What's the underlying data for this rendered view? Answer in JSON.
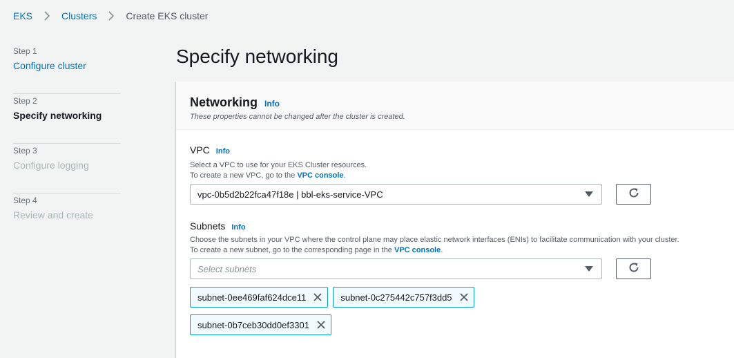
{
  "breadcrumb": {
    "items": [
      {
        "label": "EKS"
      },
      {
        "label": "Clusters"
      },
      {
        "label": "Create EKS cluster"
      }
    ]
  },
  "steps": [
    {
      "num": "Step 1",
      "label": "Configure cluster",
      "state": "link"
    },
    {
      "num": "Step 2",
      "label": "Specify networking",
      "state": "active"
    },
    {
      "num": "Step 3",
      "label": "Configure logging",
      "state": "disabled"
    },
    {
      "num": "Step 4",
      "label": "Review and create",
      "state": "disabled"
    }
  ],
  "page": {
    "title": "Specify networking"
  },
  "networking": {
    "title": "Networking",
    "info": "Info",
    "description": "These properties cannot be changed after the cluster is created."
  },
  "vpc": {
    "label": "VPC",
    "info": "Info",
    "desc_line1": "Select a VPC to use for your EKS Cluster resources.",
    "desc_line2_prefix": "To create a new VPC, go to the ",
    "desc_link": "VPC console",
    "desc_line2_suffix": ".",
    "selected": "vpc-0b5d2b22fca47f18e | bbl-eks-service-VPC"
  },
  "subnets": {
    "label": "Subnets",
    "info": "Info",
    "desc_line1": "Choose the subnets in your VPC where the control plane may place elastic network interfaces (ENIs) to facilitate communication with your cluster.",
    "desc_line2_prefix": "To create a new subnet, go to the corresponding page in the ",
    "desc_link": "VPC console",
    "desc_line2_suffix": ".",
    "placeholder": "Select subnets",
    "tokens": [
      "subnet-0ee469faf624dce11",
      "subnet-0c275442c757f3dd5",
      "subnet-0b7ceb30dd0ef3301"
    ]
  }
}
